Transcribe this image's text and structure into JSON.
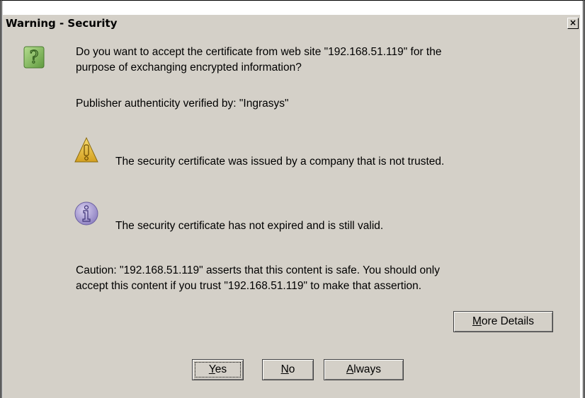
{
  "window": {
    "title": "Warning - Security",
    "close_glyph": "×"
  },
  "question": {
    "icon": "question-icon",
    "line1": "Do you want to accept the certificate from web site \"192.168.51.119\" for the",
    "line2": "purpose of exchanging encrypted information?"
  },
  "publisher": "Publisher authenticity verified by: \"Ingrasys\"",
  "warning": {
    "icon": "warning-icon",
    "text": "The security certificate was issued by a company that is not trusted."
  },
  "info": {
    "icon": "info-icon",
    "text": "The security certificate has not expired and is still valid."
  },
  "caution": {
    "line1": "Caution: \"192.168.51.119\" asserts that this content is safe. You should only",
    "line2": "accept this content if you trust \"192.168.51.119\" to make that assertion."
  },
  "buttons": {
    "more_details": {
      "mnemonic": "M",
      "rest": "ore Details"
    },
    "yes": {
      "mnemonic": "Y",
      "rest": "es"
    },
    "no": {
      "mnemonic": "N",
      "rest": "o"
    },
    "always": {
      "mnemonic": "A",
      "rest": "lways"
    }
  },
  "colors": {
    "dialog_bg": "#d4d0c8",
    "question_icon": "#8fbf6a",
    "warning_icon": "#e8c040",
    "info_icon": "#a79bd0"
  }
}
